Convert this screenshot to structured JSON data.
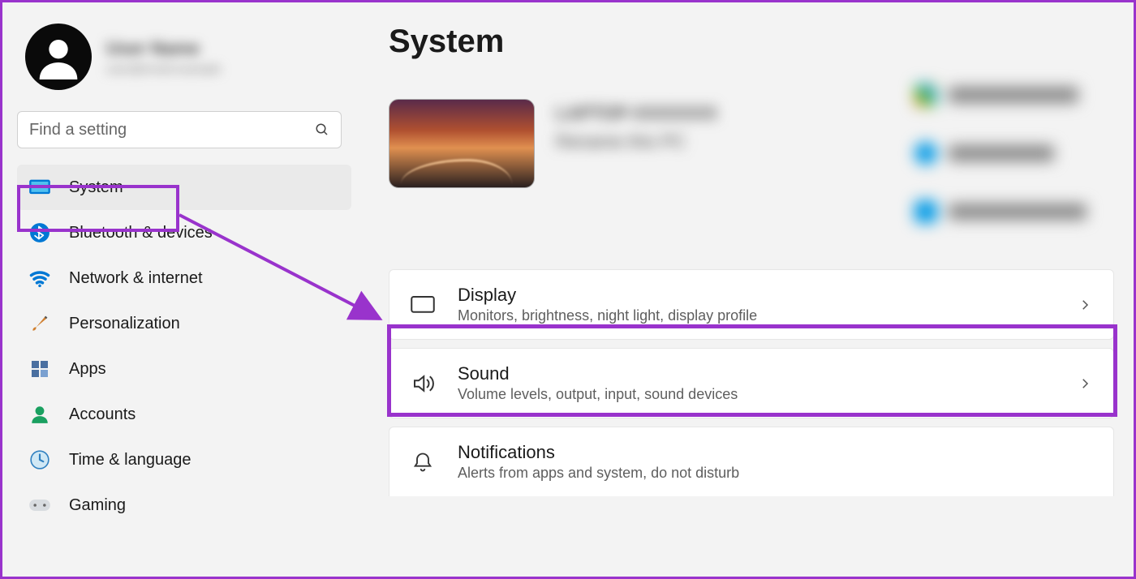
{
  "profile": {
    "name_redacted": "User Name",
    "sub_redacted": "user@email.example"
  },
  "search": {
    "placeholder": "Find a setting"
  },
  "sidebar": {
    "items": [
      {
        "key": "system",
        "label": "System",
        "selected": true
      },
      {
        "key": "bluetooth",
        "label": "Bluetooth & devices"
      },
      {
        "key": "network",
        "label": "Network & internet"
      },
      {
        "key": "personalization",
        "label": "Personalization"
      },
      {
        "key": "apps",
        "label": "Apps"
      },
      {
        "key": "accounts",
        "label": "Accounts"
      },
      {
        "key": "time",
        "label": "Time & language"
      },
      {
        "key": "gaming",
        "label": "Gaming"
      }
    ]
  },
  "page": {
    "title": "System"
  },
  "device": {
    "name_redacted": "LAPTOP-XXXXXXX",
    "sub_redacted": "Rename this PC"
  },
  "settings_cards": [
    {
      "key": "display",
      "title": "Display",
      "sub": "Monitors, brightness, night light, display profile"
    },
    {
      "key": "sound",
      "title": "Sound",
      "sub": "Volume levels, output, input, sound devices"
    },
    {
      "key": "notifications",
      "title": "Notifications",
      "sub": "Alerts from apps and system, do not disturb"
    }
  ],
  "colors": {
    "accent_purple": "#9933cc"
  }
}
